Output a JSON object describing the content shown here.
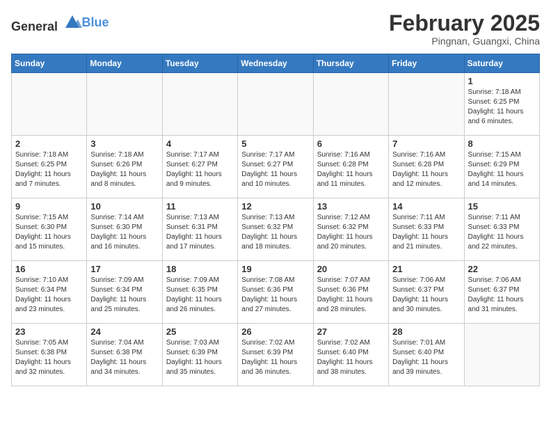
{
  "header": {
    "logo_general": "General",
    "logo_blue": "Blue",
    "month_title": "February 2025",
    "subtitle": "Pingnan, Guangxi, China"
  },
  "weekdays": [
    "Sunday",
    "Monday",
    "Tuesday",
    "Wednesday",
    "Thursday",
    "Friday",
    "Saturday"
  ],
  "weeks": [
    [
      {
        "day": "",
        "info": ""
      },
      {
        "day": "",
        "info": ""
      },
      {
        "day": "",
        "info": ""
      },
      {
        "day": "",
        "info": ""
      },
      {
        "day": "",
        "info": ""
      },
      {
        "day": "",
        "info": ""
      },
      {
        "day": "1",
        "info": "Sunrise: 7:18 AM\nSunset: 6:25 PM\nDaylight: 11 hours and 6 minutes."
      }
    ],
    [
      {
        "day": "2",
        "info": "Sunrise: 7:18 AM\nSunset: 6:25 PM\nDaylight: 11 hours and 7 minutes."
      },
      {
        "day": "3",
        "info": "Sunrise: 7:18 AM\nSunset: 6:26 PM\nDaylight: 11 hours and 8 minutes."
      },
      {
        "day": "4",
        "info": "Sunrise: 7:17 AM\nSunset: 6:27 PM\nDaylight: 11 hours and 9 minutes."
      },
      {
        "day": "5",
        "info": "Sunrise: 7:17 AM\nSunset: 6:27 PM\nDaylight: 11 hours and 10 minutes."
      },
      {
        "day": "6",
        "info": "Sunrise: 7:16 AM\nSunset: 6:28 PM\nDaylight: 11 hours and 11 minutes."
      },
      {
        "day": "7",
        "info": "Sunrise: 7:16 AM\nSunset: 6:28 PM\nDaylight: 11 hours and 12 minutes."
      },
      {
        "day": "8",
        "info": "Sunrise: 7:15 AM\nSunset: 6:29 PM\nDaylight: 11 hours and 14 minutes."
      }
    ],
    [
      {
        "day": "9",
        "info": "Sunrise: 7:15 AM\nSunset: 6:30 PM\nDaylight: 11 hours and 15 minutes."
      },
      {
        "day": "10",
        "info": "Sunrise: 7:14 AM\nSunset: 6:30 PM\nDaylight: 11 hours and 16 minutes."
      },
      {
        "day": "11",
        "info": "Sunrise: 7:13 AM\nSunset: 6:31 PM\nDaylight: 11 hours and 17 minutes."
      },
      {
        "day": "12",
        "info": "Sunrise: 7:13 AM\nSunset: 6:32 PM\nDaylight: 11 hours and 18 minutes."
      },
      {
        "day": "13",
        "info": "Sunrise: 7:12 AM\nSunset: 6:32 PM\nDaylight: 11 hours and 20 minutes."
      },
      {
        "day": "14",
        "info": "Sunrise: 7:11 AM\nSunset: 6:33 PM\nDaylight: 11 hours and 21 minutes."
      },
      {
        "day": "15",
        "info": "Sunrise: 7:11 AM\nSunset: 6:33 PM\nDaylight: 11 hours and 22 minutes."
      }
    ],
    [
      {
        "day": "16",
        "info": "Sunrise: 7:10 AM\nSunset: 6:34 PM\nDaylight: 11 hours and 23 minutes."
      },
      {
        "day": "17",
        "info": "Sunrise: 7:09 AM\nSunset: 6:34 PM\nDaylight: 11 hours and 25 minutes."
      },
      {
        "day": "18",
        "info": "Sunrise: 7:09 AM\nSunset: 6:35 PM\nDaylight: 11 hours and 26 minutes."
      },
      {
        "day": "19",
        "info": "Sunrise: 7:08 AM\nSunset: 6:36 PM\nDaylight: 11 hours and 27 minutes."
      },
      {
        "day": "20",
        "info": "Sunrise: 7:07 AM\nSunset: 6:36 PM\nDaylight: 11 hours and 28 minutes."
      },
      {
        "day": "21",
        "info": "Sunrise: 7:06 AM\nSunset: 6:37 PM\nDaylight: 11 hours and 30 minutes."
      },
      {
        "day": "22",
        "info": "Sunrise: 7:06 AM\nSunset: 6:37 PM\nDaylight: 11 hours and 31 minutes."
      }
    ],
    [
      {
        "day": "23",
        "info": "Sunrise: 7:05 AM\nSunset: 6:38 PM\nDaylight: 11 hours and 32 minutes."
      },
      {
        "day": "24",
        "info": "Sunrise: 7:04 AM\nSunset: 6:38 PM\nDaylight: 11 hours and 34 minutes."
      },
      {
        "day": "25",
        "info": "Sunrise: 7:03 AM\nSunset: 6:39 PM\nDaylight: 11 hours and 35 minutes."
      },
      {
        "day": "26",
        "info": "Sunrise: 7:02 AM\nSunset: 6:39 PM\nDaylight: 11 hours and 36 minutes."
      },
      {
        "day": "27",
        "info": "Sunrise: 7:02 AM\nSunset: 6:40 PM\nDaylight: 11 hours and 38 minutes."
      },
      {
        "day": "28",
        "info": "Sunrise: 7:01 AM\nSunset: 6:40 PM\nDaylight: 11 hours and 39 minutes."
      },
      {
        "day": "",
        "info": ""
      }
    ]
  ]
}
